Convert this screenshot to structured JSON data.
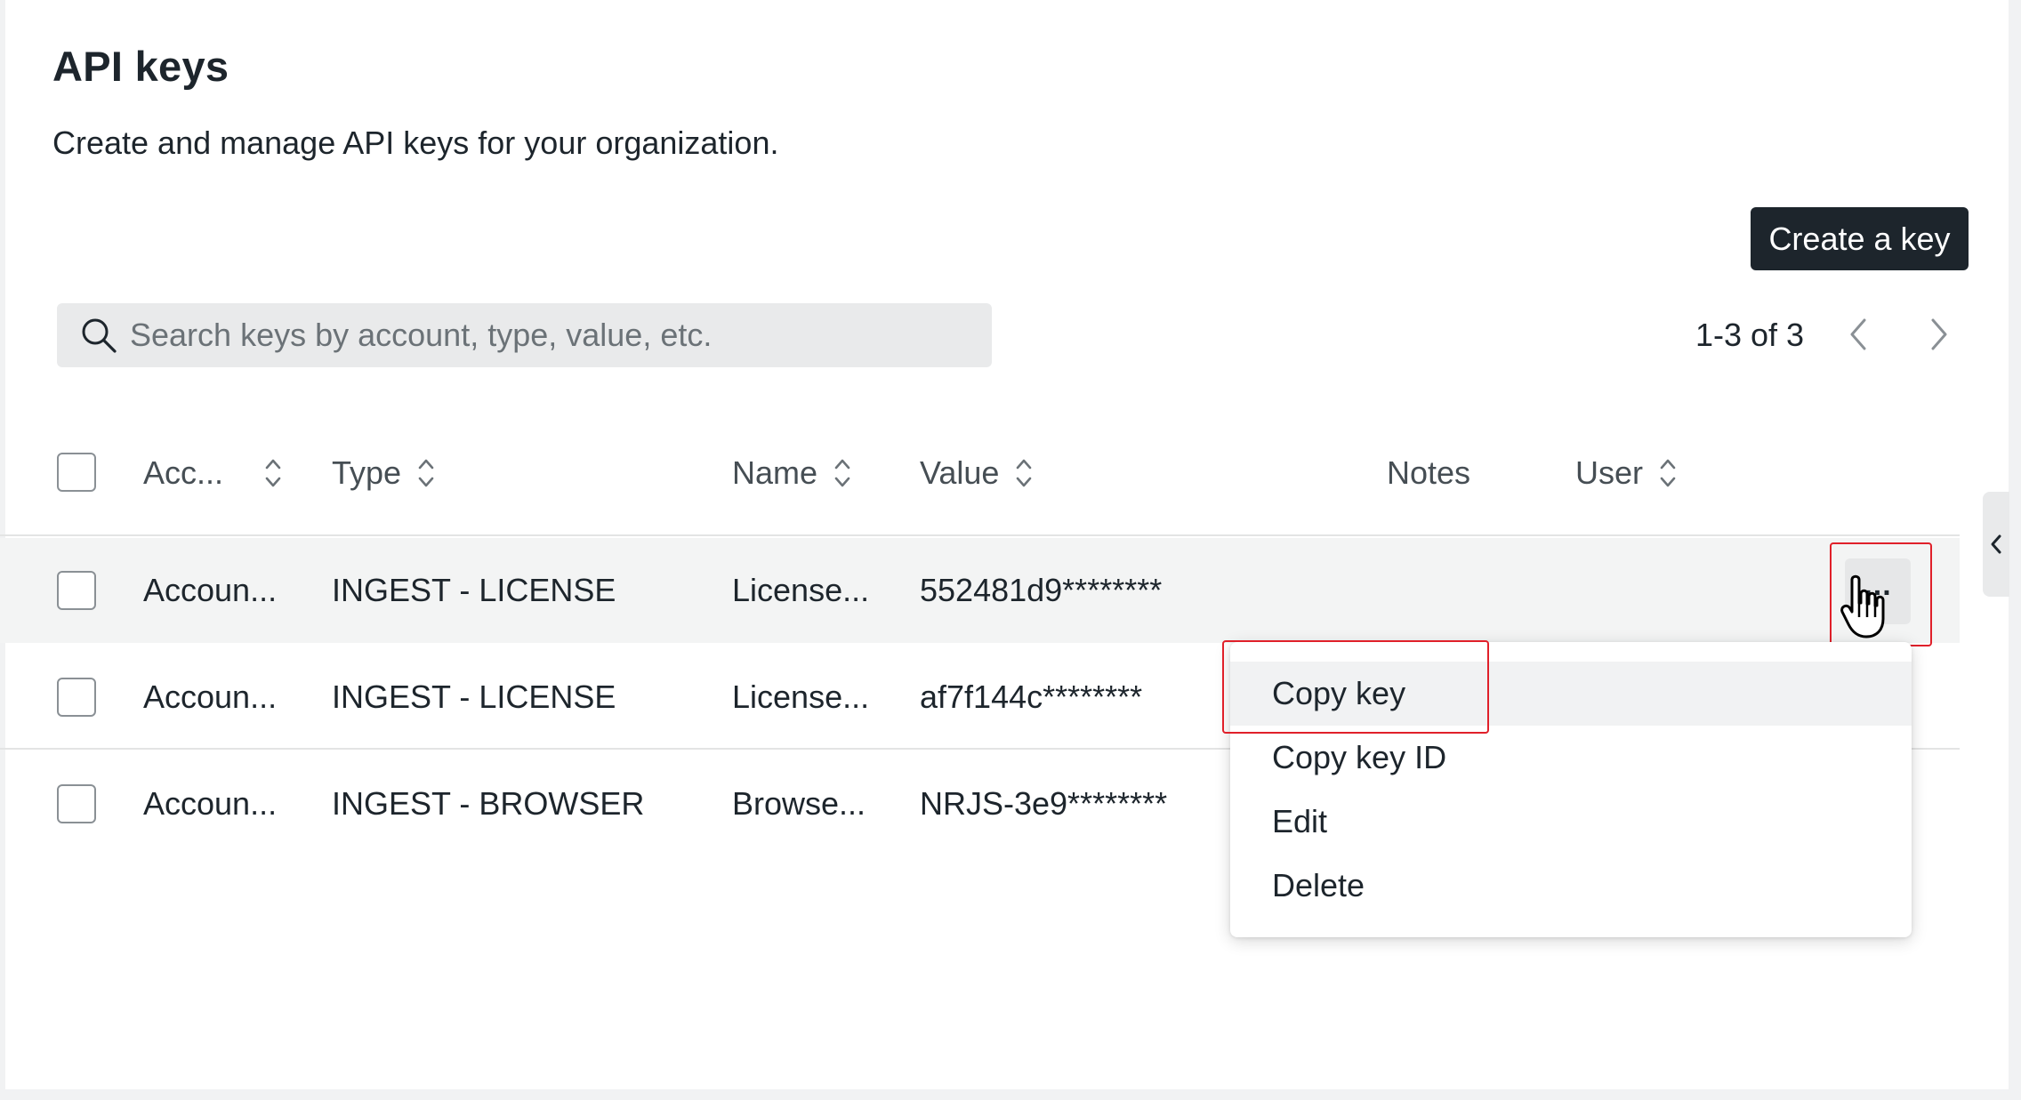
{
  "page": {
    "title": "API keys",
    "subtitle": "Create and manage API keys for your organization."
  },
  "toolbar": {
    "create_label": "Create a key",
    "search_placeholder": "Search keys by account, type, value, etc.",
    "pagination_text": "1-3 of 3"
  },
  "table": {
    "columns": {
      "account": "Acc...",
      "type": "Type",
      "name": "Name",
      "value": "Value",
      "notes": "Notes",
      "user": "User"
    },
    "rows": [
      {
        "account": "Accoun...",
        "type": "INGEST - LICENSE",
        "name": "License...",
        "value": "552481d9********",
        "notes": "",
        "user": ""
      },
      {
        "account": "Accoun...",
        "type": "INGEST - LICENSE",
        "name": "License...",
        "value": "af7f144c********",
        "notes": "",
        "user": ""
      },
      {
        "account": "Accoun...",
        "type": "INGEST - BROWSER",
        "name": "Browse...",
        "value": "NRJS-3e9********",
        "notes": "",
        "user": ""
      }
    ]
  },
  "actions_menu": {
    "trigger_label": "...",
    "items": [
      "Copy key",
      "Copy key ID",
      "Edit",
      "Delete"
    ]
  },
  "icons": {
    "search": "search-icon",
    "sort": "sort-icon",
    "prev": "chevron-left-icon",
    "next": "chevron-right-icon",
    "more": "more-horizontal-icon",
    "cursor": "hand-cursor-icon",
    "collapse": "chevron-left-icon"
  },
  "colors": {
    "primary_button": "#1d252c",
    "highlight_frame": "#e0202a",
    "row_hover": "#f3f4f4",
    "search_bg": "#e9eaeb"
  }
}
